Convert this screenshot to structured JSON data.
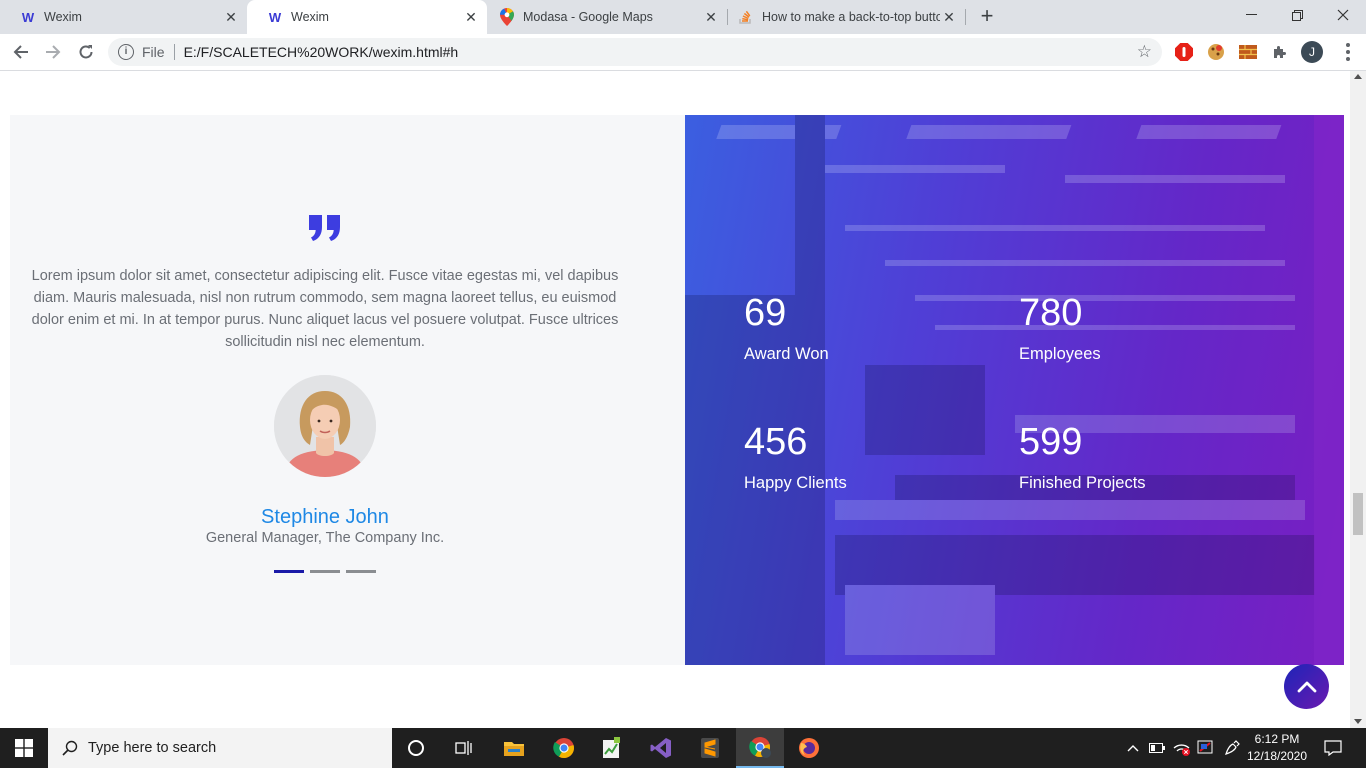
{
  "browser": {
    "tabs": [
      {
        "title": "Wexim",
        "favicon": "wexim-logo-icon",
        "active": false
      },
      {
        "title": "Wexim",
        "favicon": "wexim-logo-icon",
        "active": true
      },
      {
        "title": "Modasa - Google Maps",
        "favicon": "google-maps-icon",
        "active": false
      },
      {
        "title": "How to make a back-to-top butto",
        "favicon": "stackoverflow-icon",
        "active": false
      }
    ],
    "address": {
      "scheme_label": "File",
      "url": "E:/F/SCALETECH%20WORK/wexim.html#h"
    },
    "profile_initial": "J"
  },
  "testimonial": {
    "quote": "Lorem ipsum dolor sit amet, consectetur adipiscing elit. Fusce vitae egestas mi, vel dapibus diam. Mauris malesuada, nisl non rutrum commodo, sem magna laoreet tellus, eu euismod dolor enim et mi. In at tempor purus. Nunc aliquet lacus vel posuere volutpat. Fusce ultrices sollicitudin nisl nec elementum.",
    "name": "Stephine John",
    "role": "General Manager, The Company Inc.",
    "slides": 3,
    "active_slide": 0
  },
  "stats": [
    {
      "value": "69",
      "label": "Award Won"
    },
    {
      "value": "780",
      "label": "Employees"
    },
    {
      "value": "456",
      "label": "Happy Clients"
    },
    {
      "value": "599",
      "label": "Finished Projects"
    }
  ],
  "taskbar": {
    "search_placeholder": "Type here to search",
    "time": "6:12 PM",
    "date": "12/18/2020"
  },
  "colors": {
    "accent_blue": "#1e88e5",
    "quote_icon": "#3d3de0",
    "stats_gradient_start": "#3b5fe0",
    "stats_gradient_end": "#7a1ec2"
  }
}
